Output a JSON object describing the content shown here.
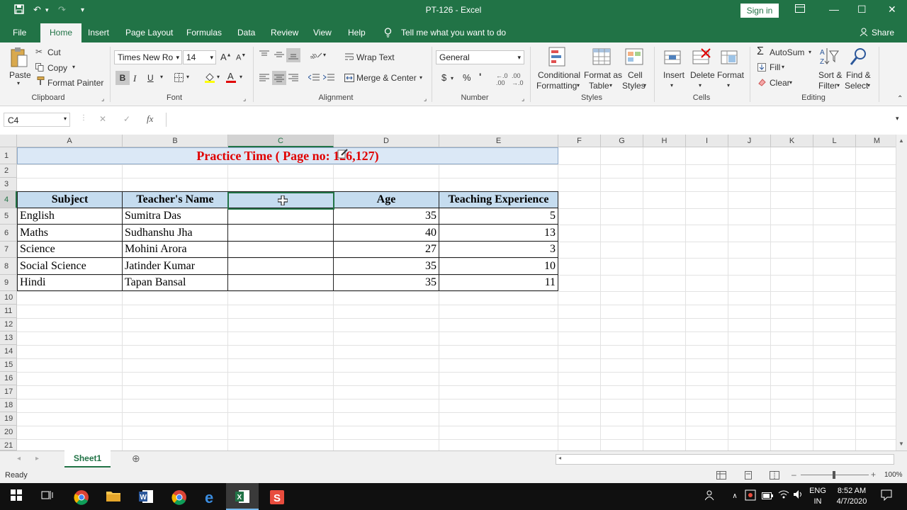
{
  "window": {
    "title": "PT-126  -  Excel",
    "sign_in": "Sign in",
    "minimize": "—",
    "restore": "☐",
    "close": "✕",
    "save_glyph": "💾",
    "undo_glyph": "↶",
    "redo_glyph": "↷",
    "customize_glyph": "▾"
  },
  "tabs": [
    "File",
    "Home",
    "Insert",
    "Page Layout",
    "Formulas",
    "Data",
    "Review",
    "View",
    "Help"
  ],
  "tell_me": "Tell me what you want to do",
  "share": "Share",
  "ribbon": {
    "clipboard": {
      "paste": "Paste",
      "cut": "Cut",
      "copy": "Copy",
      "format_painter": "Format Painter",
      "group": "Clipboard"
    },
    "font": {
      "name": "Times New Ro",
      "size": "14",
      "bold": "B",
      "italic": "I",
      "underline": "U",
      "group": "Font"
    },
    "alignment": {
      "wrap_text": "Wrap Text",
      "merge_center": "Merge & Center",
      "group": "Alignment"
    },
    "number": {
      "format": "General",
      "currency": "$",
      "percent": "%",
      "comma": "'",
      "group": "Number"
    },
    "styles": {
      "conditional": "Conditional",
      "formatting": "Formatting",
      "format_as": "Format as",
      "table": "Table",
      "cell": "Cell",
      "cell_styles": "Styles",
      "group": "Styles"
    },
    "cells": {
      "insert": "Insert",
      "delete": "Delete",
      "format": "Format",
      "group": "Cells"
    },
    "editing": {
      "autosum": "AutoSum",
      "fill": "Fill",
      "clear": "Clear",
      "sort": "Sort &",
      "filter": "Filter",
      "find": "Find &",
      "select": "Select",
      "group": "Editing"
    }
  },
  "formula_bar": {
    "name_box": "C4",
    "fx": "fx",
    "cancel": "✕",
    "enter": "✓",
    "value": ""
  },
  "columns": [
    "A",
    "B",
    "C",
    "D",
    "E",
    "F",
    "G",
    "H",
    "I",
    "J",
    "K",
    "L",
    "M"
  ],
  "rows": [
    "1",
    "2",
    "3",
    "4",
    "5",
    "6",
    "7",
    "8",
    "9",
    "10",
    "11",
    "12",
    "13",
    "14",
    "15",
    "16",
    "17",
    "18",
    "19",
    "20",
    "21"
  ],
  "sheet": {
    "title": "Practice Time ( Page no: 126,127)",
    "headers": [
      "Subject",
      "Teacher's Name",
      "",
      "Age",
      "Teaching Experience"
    ],
    "data": [
      [
        "English",
        "Sumitra Das",
        "",
        "35",
        "5"
      ],
      [
        "Maths",
        "Sudhanshu Jha",
        "",
        "40",
        "13"
      ],
      [
        "Science",
        "Mohini Arora",
        "",
        "27",
        "3"
      ],
      [
        "Social Science",
        "Jatinder Kumar",
        "",
        "35",
        "10"
      ],
      [
        "Hindi",
        "Tapan Bansal",
        "",
        "35",
        "11"
      ]
    ]
  },
  "sheet_tab": "Sheet1",
  "add_sheet": "⊕",
  "status": {
    "ready": "Ready",
    "zoom": "100%"
  },
  "taskbar": {
    "lang_top": "ENG",
    "lang_bottom": "IN",
    "time": "8:52 AM",
    "date": "4/7/2020"
  },
  "colors": {
    "accent": "#217346",
    "title_red": "#e00000",
    "header_fill": "#c5dcef"
  }
}
